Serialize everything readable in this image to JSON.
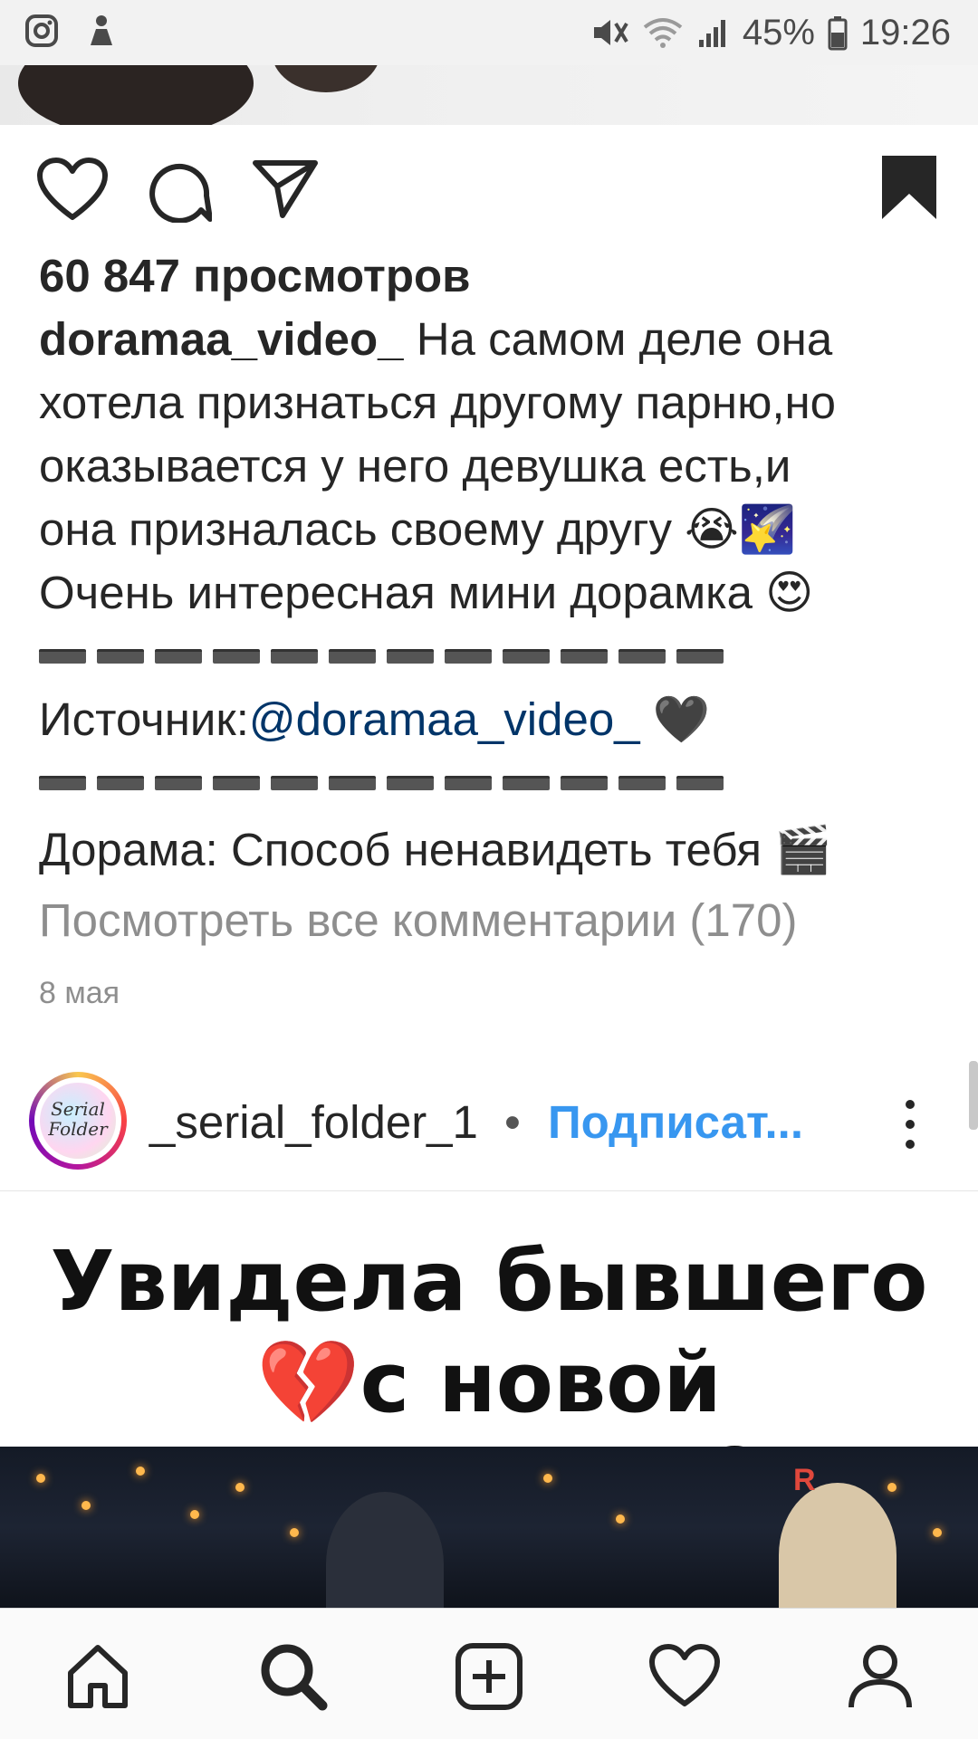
{
  "status_bar": {
    "battery": "45%",
    "time": "19:26"
  },
  "post": {
    "views": "60 847 просмотров",
    "username": "doramaa_video_",
    "caption_lines": [
      "На самом деле она",
      "хотела признаться другому парню,но",
      "оказывается у него девушка есть,и",
      "она призналась своему другу 😭🌠",
      "Очень интересная мини дорамка 😍"
    ],
    "source_label": "Источник:",
    "source_link": "@doramaa_video_",
    "source_emoji": "🖤",
    "drama_line": "Дорама: Способ ненавидеть тебя 🎬",
    "view_comments": "Посмотреть все комментарии (170)",
    "date": "8 мая"
  },
  "next_post": {
    "username": "_serial_folder_1",
    "separator": "•",
    "follow_label": "Подписат...",
    "avatar_text": "Serial Folder",
    "video_title_line1": "Увидела бывшего",
    "video_title_line2": "💔с новой девушкой😞"
  },
  "icons": {
    "like": "heart-outline-icon",
    "comment": "comment-icon",
    "share": "paper-plane-icon",
    "save": "bookmark-filled-icon",
    "home": "home-icon",
    "search": "search-icon",
    "add": "add-post-icon",
    "activity": "heart-outline-icon",
    "profile": "profile-icon"
  }
}
